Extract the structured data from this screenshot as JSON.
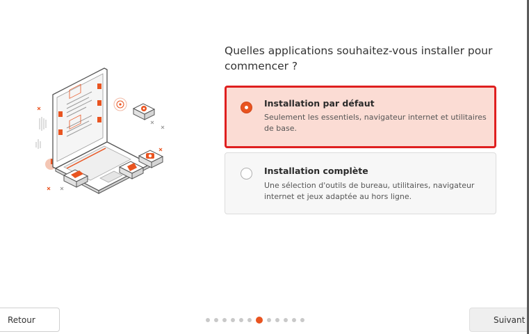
{
  "question": "Quelles applications souhaitez-vous installer pour commencer ?",
  "options": [
    {
      "title": "Installation par défaut",
      "description": "Seulement les essentiels, navigateur internet et utilitaires de base.",
      "selected": true
    },
    {
      "title": "Installation complète",
      "description": "Une sélection d'outils de bureau, utilitaires, navigateur internet et jeux adaptée au hors ligne.",
      "selected": false
    }
  ],
  "navigation": {
    "back_label": "Retour",
    "next_label": "Suivant"
  },
  "progress": {
    "total_steps": 12,
    "current_step": 7
  },
  "colors": {
    "accent": "#e95420",
    "selected_background": "#fbdcd4",
    "selected_border": "#df1f1f"
  },
  "illustration": {
    "icon": "laptop-with-apps-illustration"
  }
}
